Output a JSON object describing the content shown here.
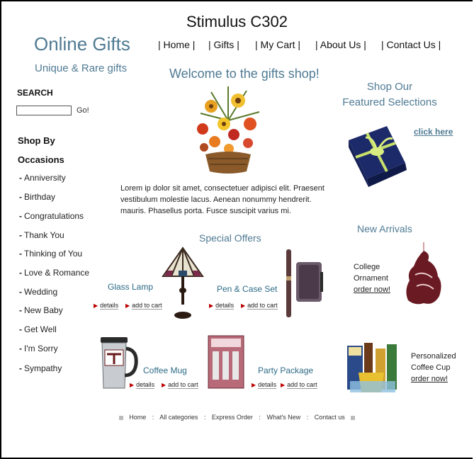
{
  "stimulus_title": "Stimulus C302",
  "header": {
    "logo": "Online Gifts",
    "tagline": "Unique & Rare gifts",
    "nav": [
      "| Home |",
      "| Gifts |",
      "| My Cart |",
      "| About Us |",
      "| Contact Us |"
    ]
  },
  "welcome": "Welcome to the gifts shop!",
  "search": {
    "label": "SEARCH",
    "value": "",
    "go": "Go!"
  },
  "sidebar": {
    "heading_line1": "Shop By",
    "heading_line2": "Occasions",
    "items": [
      "Anniversity",
      "Birthday",
      "Congratulations",
      "Thank You",
      "Thinking of You",
      "Love & Romance",
      "Wedding",
      "New Baby",
      "Get Well",
      "I'm Sorry",
      "Sympathy"
    ]
  },
  "featured": {
    "line1": "Shop Our",
    "line2": "Featured Selections",
    "link": "click here"
  },
  "intro_text": "Lorem ip dolor sit amet, consectetuer adipisci elit. Praesent vestibulum molestie lacus. Aenean nonummy hendrerit. mauris. Phasellus porta. Fusce suscipit varius mi.",
  "special_offers": {
    "title": "Special Offers",
    "details_label": "details",
    "add_label": "add to cart",
    "products": [
      "Glass Lamp",
      "Pen & Case Set",
      "Coffee Mug",
      "Party Package"
    ]
  },
  "new_arrivals": {
    "title": "New Arrivals",
    "ornament": {
      "line1": "College",
      "line2": "Ornament",
      "link": "order now!"
    },
    "coffee": {
      "line1": "Personalized",
      "line2": "Coffee Cup",
      "link": "order now!"
    }
  },
  "footer": [
    "Home",
    "All categories",
    "Express Order",
    "What's New",
    "Contact us"
  ],
  "colors": {
    "accent": "#4f7a93",
    "product_name": "#2d6a86",
    "arrow": "#bb0000"
  }
}
